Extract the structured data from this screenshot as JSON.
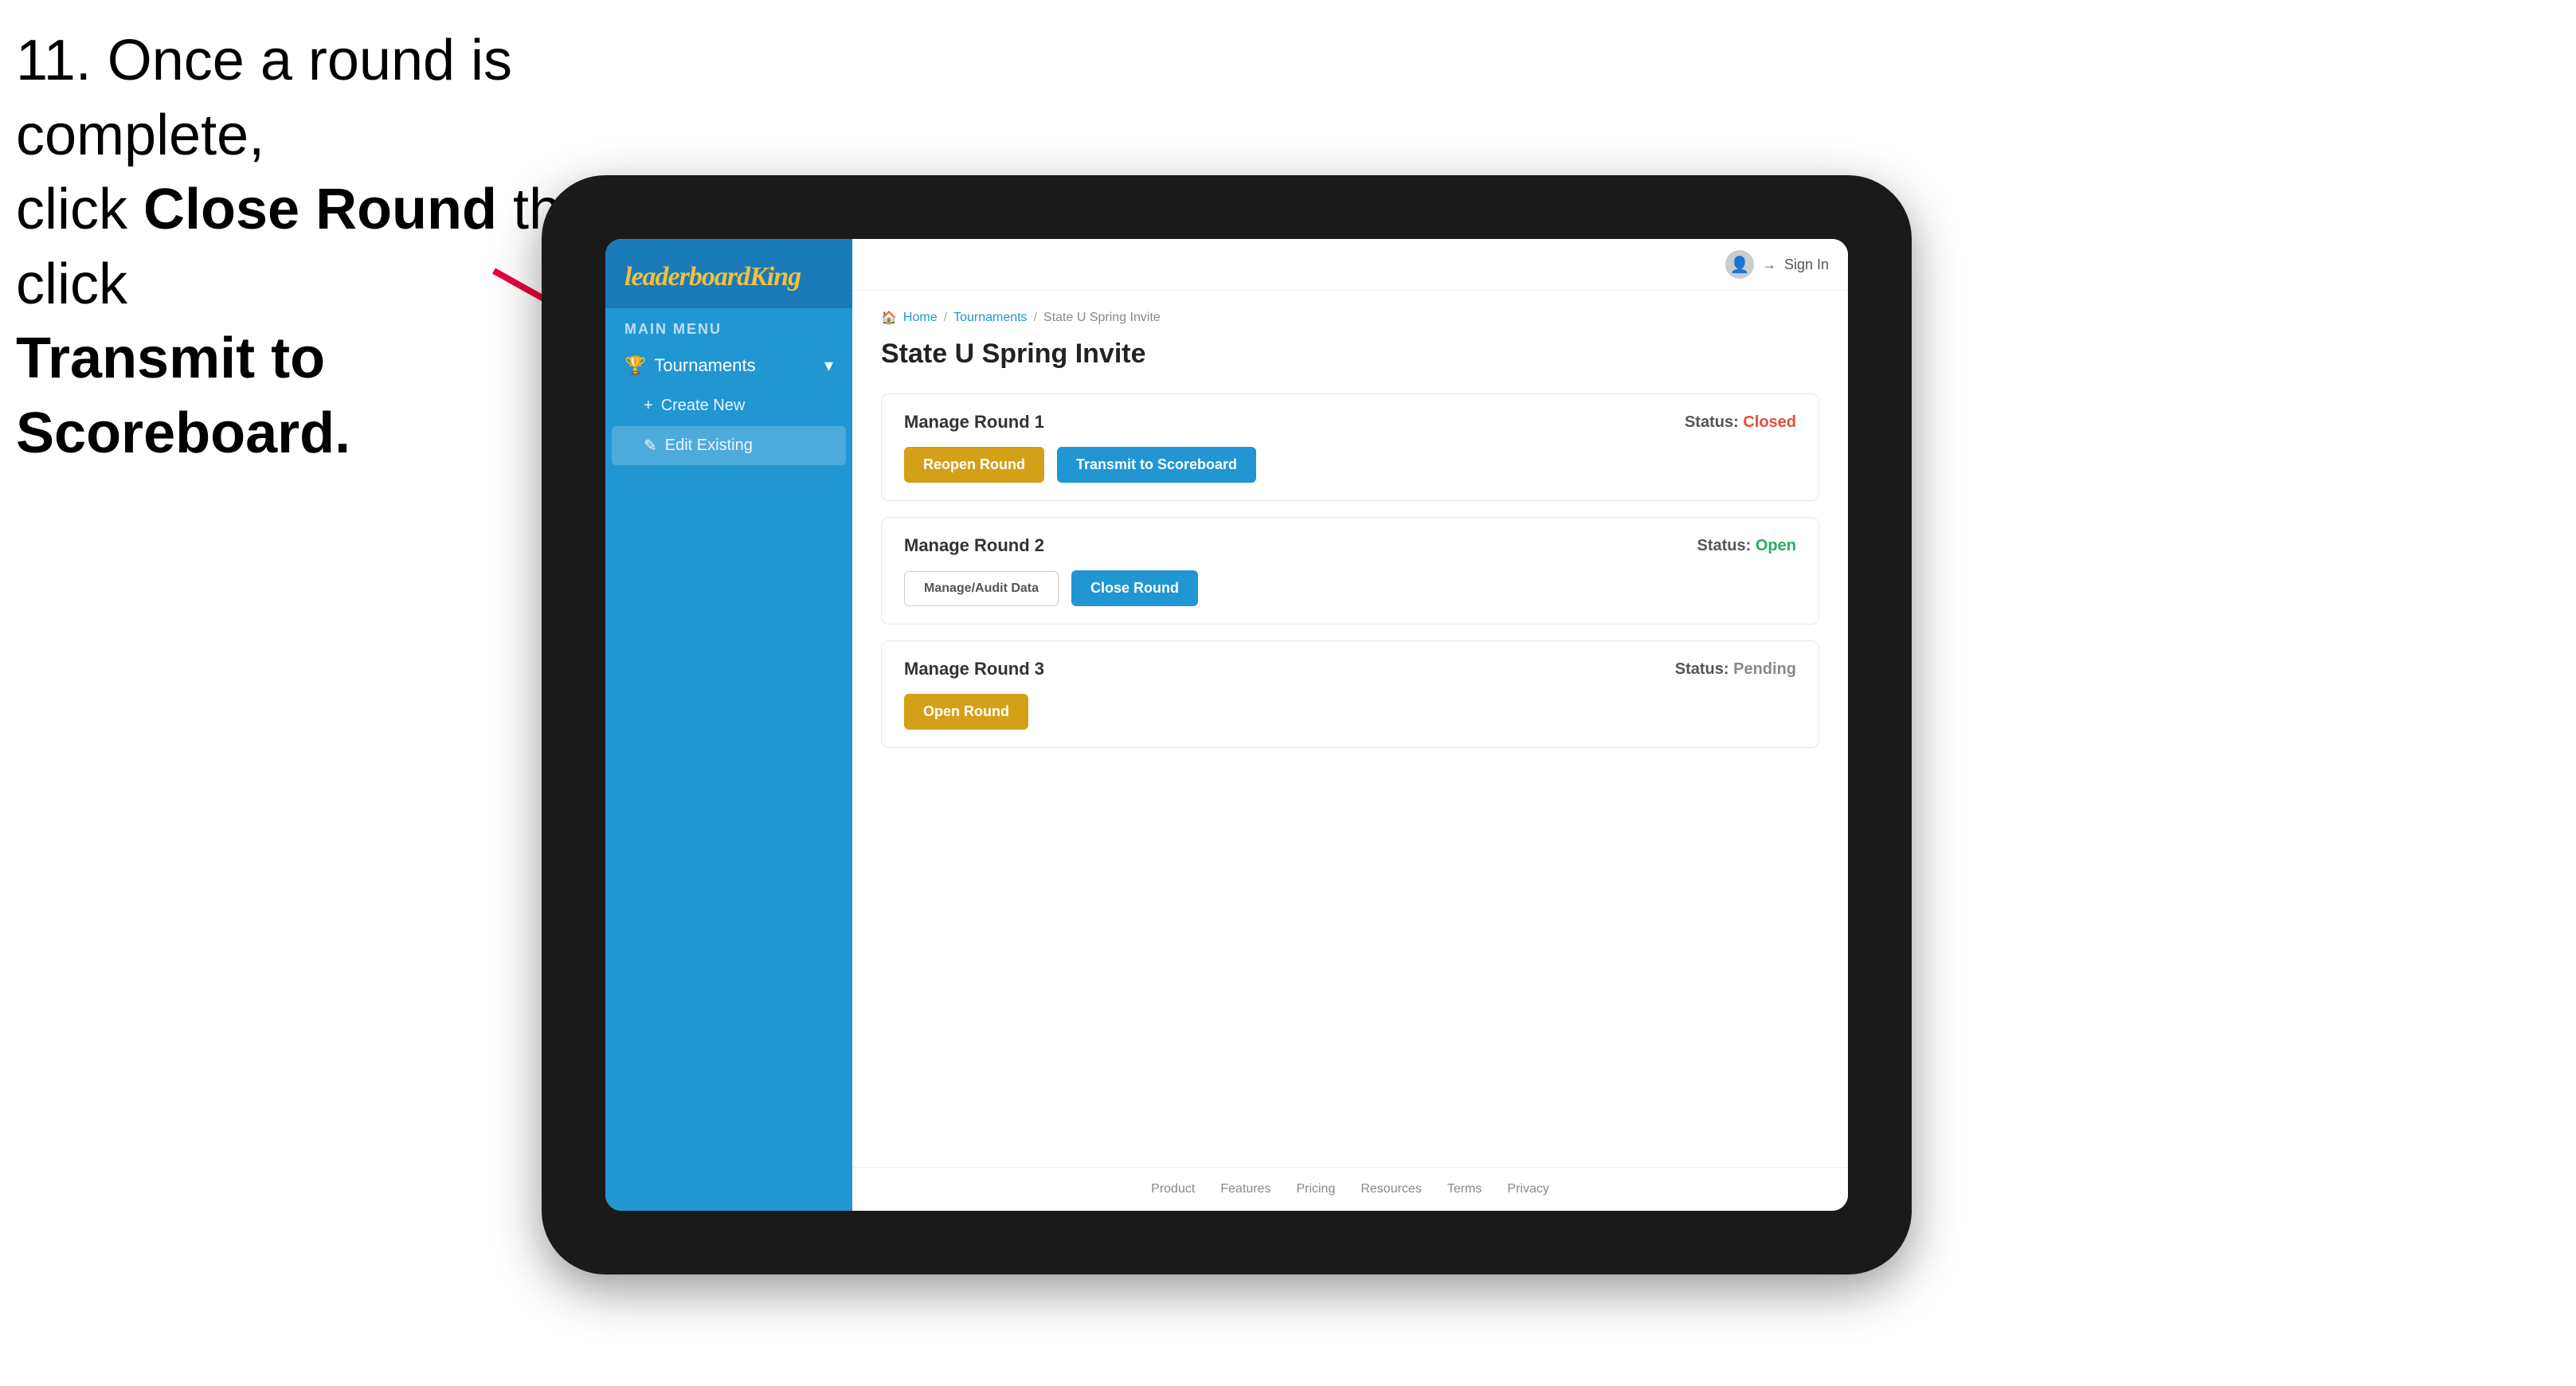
{
  "instruction": {
    "line1": "11. Once a round is complete,",
    "line2_prefix": "click ",
    "line2_bold": "Close Round",
    "line2_suffix": " then click",
    "line3_bold": "Transmit to Scoreboard."
  },
  "tablet": {
    "logo": {
      "prefix": "leaderboard",
      "suffix": "King"
    },
    "sidebar": {
      "menu_label": "MAIN MENU",
      "items": [
        {
          "label": "Tournaments",
          "expandable": true,
          "sub_items": [
            {
              "label": "Create New",
              "active": false
            },
            {
              "label": "Edit Existing",
              "active": true
            }
          ]
        }
      ]
    },
    "topbar": {
      "sign_in": "Sign In"
    },
    "breadcrumb": {
      "home": "Home",
      "tournaments": "Tournaments",
      "current": "State U Spring Invite"
    },
    "page_title": "State U Spring Invite",
    "rounds": [
      {
        "id": "round1",
        "title": "Manage Round 1",
        "status_label": "Status:",
        "status_value": "Closed",
        "status_class": "status-closed",
        "primary_button": "Reopen Round",
        "primary_btn_class": "btn-gold",
        "secondary_button": "Transmit to Scoreboard",
        "secondary_btn_class": "btn-blue"
      },
      {
        "id": "round2",
        "title": "Manage Round 2",
        "status_label": "Status:",
        "status_value": "Open",
        "status_class": "status-open",
        "audit_button": "Manage/Audit Data",
        "primary_button": "Close Round",
        "primary_btn_class": "btn-blue"
      },
      {
        "id": "round3",
        "title": "Manage Round 3",
        "status_label": "Status:",
        "status_value": "Pending",
        "status_class": "status-pending",
        "primary_button": "Open Round",
        "primary_btn_class": "btn-gold"
      }
    ],
    "footer": {
      "links": [
        "Product",
        "Features",
        "Pricing",
        "Resources",
        "Terms",
        "Privacy"
      ]
    }
  }
}
